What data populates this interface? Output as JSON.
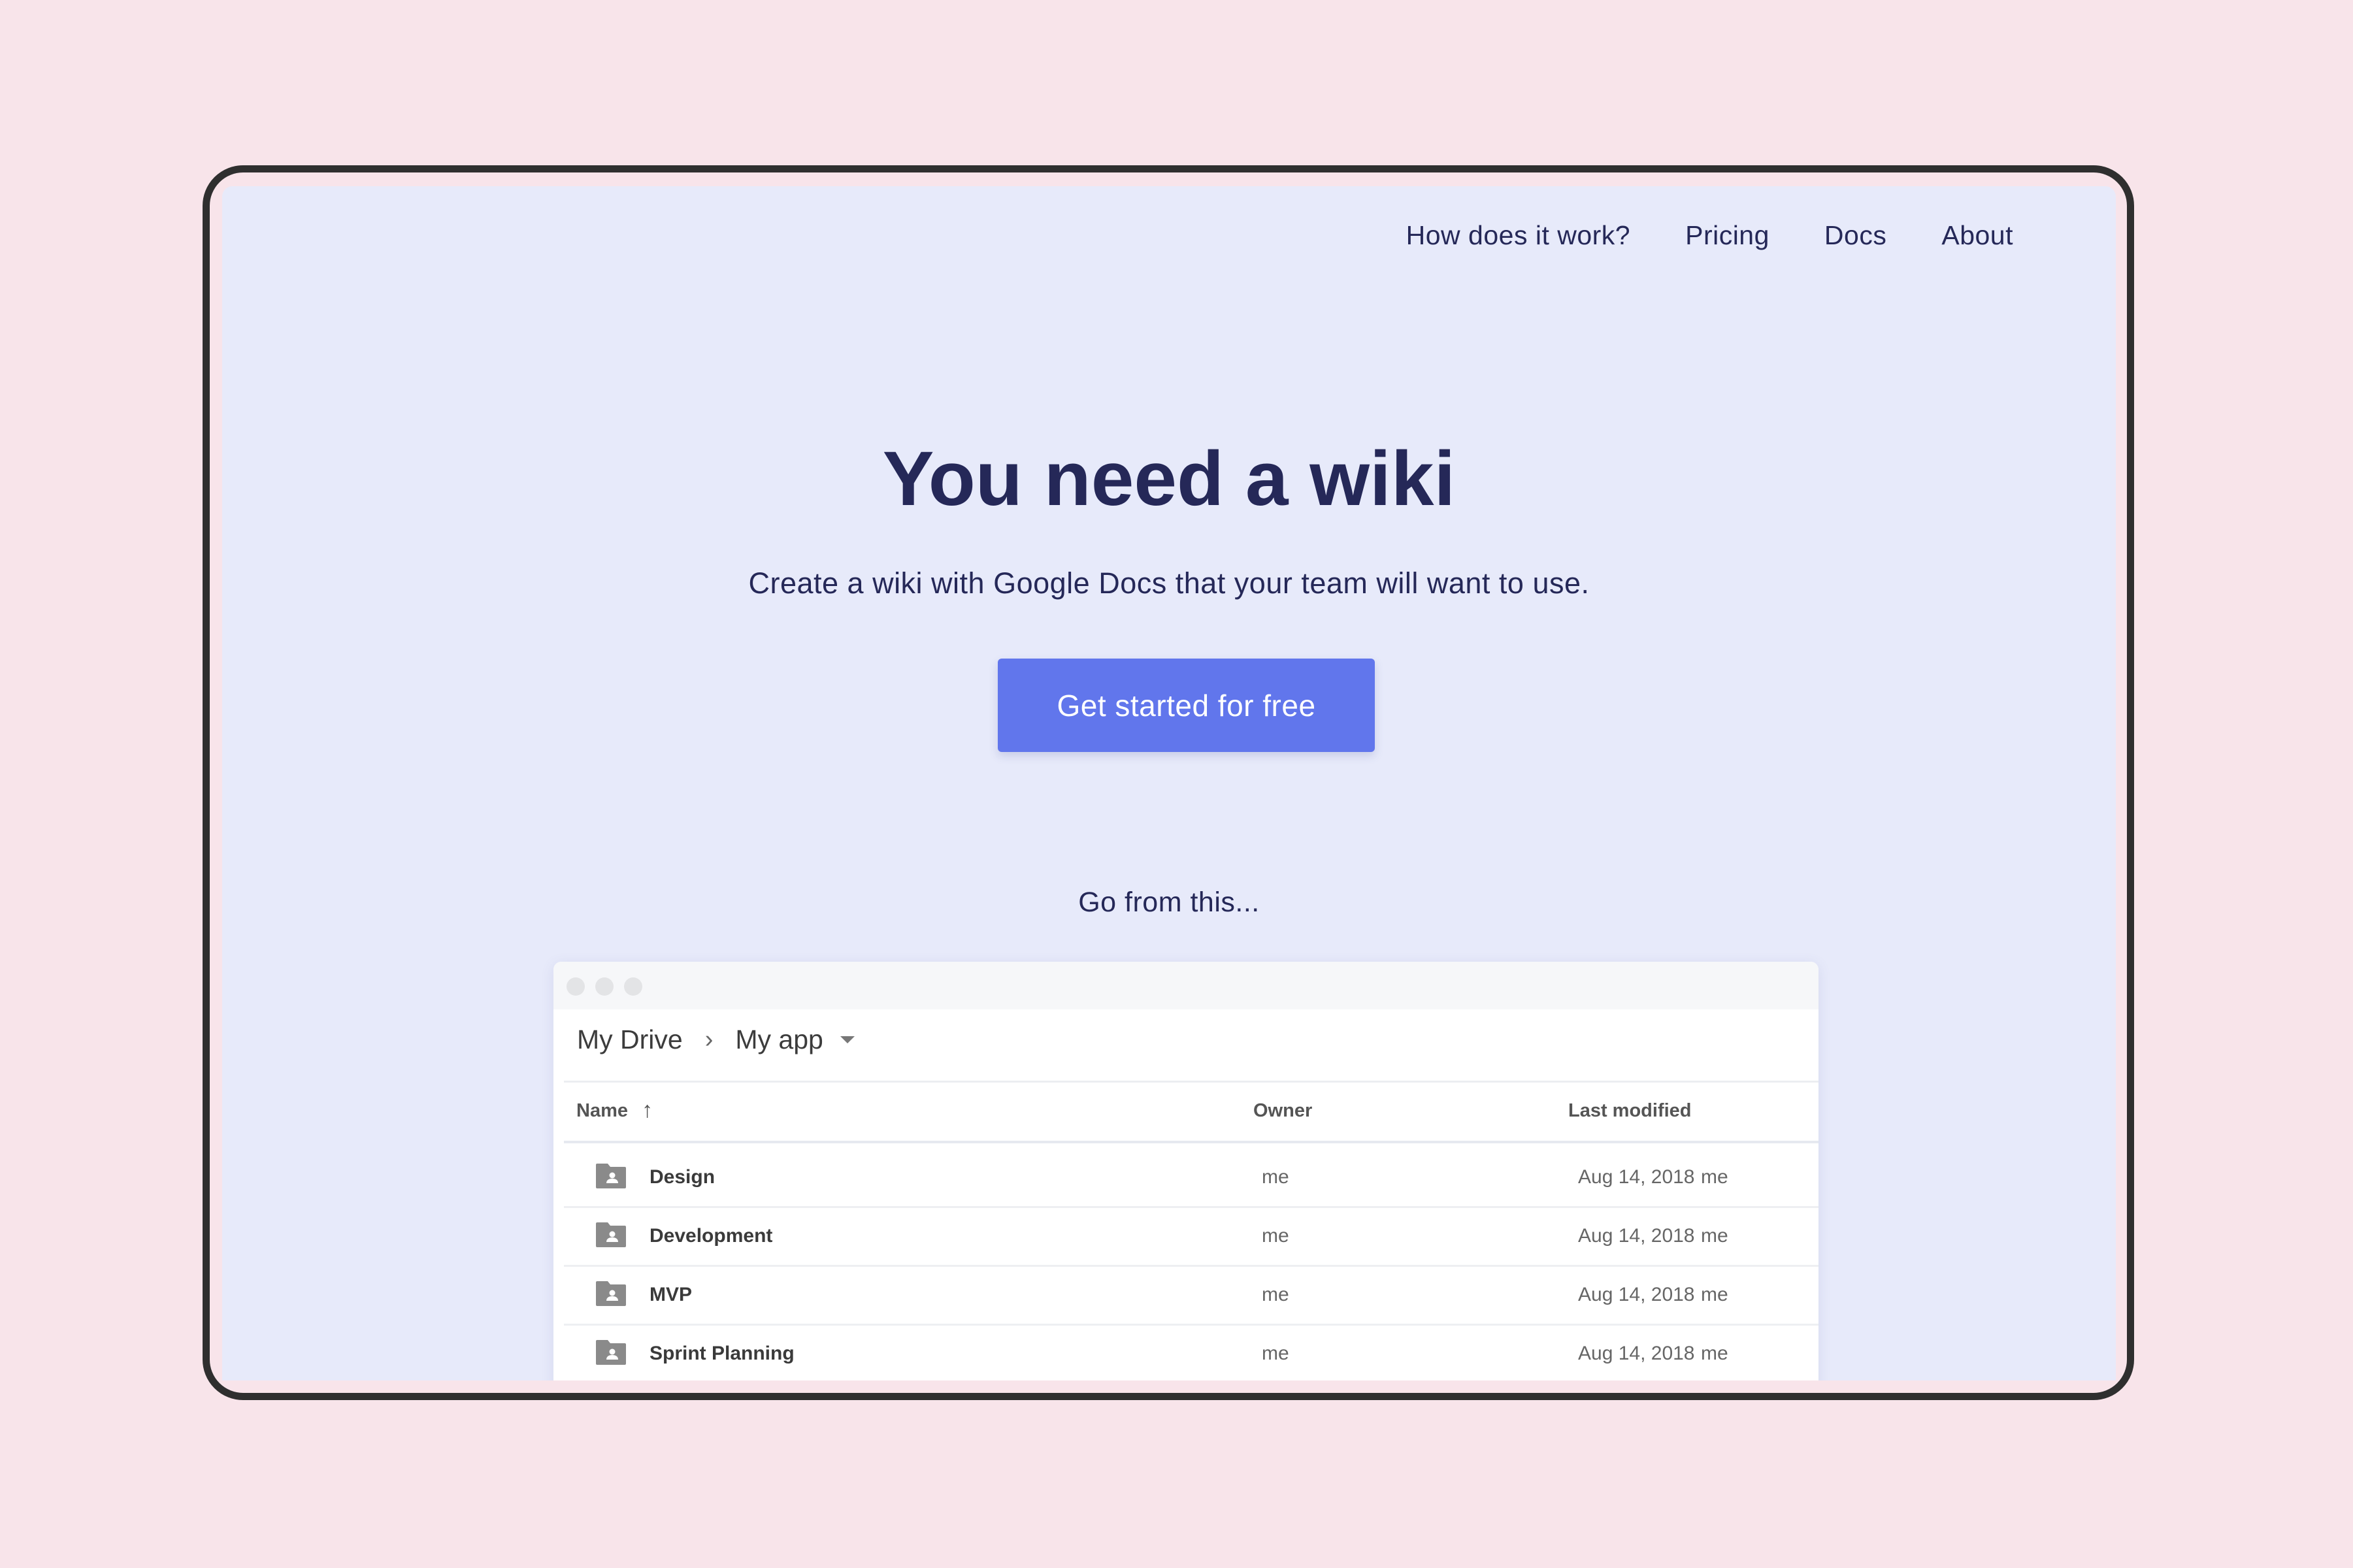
{
  "nav": {
    "items": [
      {
        "label": "How does it work?"
      },
      {
        "label": "Pricing"
      },
      {
        "label": "Docs"
      },
      {
        "label": "About"
      }
    ]
  },
  "hero": {
    "title": "You need a wiki",
    "subtitle": "Create a wiki with Google Docs that your team will want to use.",
    "cta_label": "Get started for free",
    "go_from": "Go from this..."
  },
  "colors": {
    "background": "#f8e4ea",
    "page": "#e7eafa",
    "text": "#252858",
    "accent": "#6176ec",
    "frame": "#2f2f2f"
  },
  "drive": {
    "breadcrumb": {
      "root": "My Drive",
      "current": "My app",
      "separator_icon": "chevron-right-icon",
      "dropdown_icon": "caret-down-icon"
    },
    "columns": {
      "name": "Name",
      "owner": "Owner",
      "modified": "Last modified",
      "sort_icon": "arrow-up-icon"
    },
    "rows": [
      {
        "name": "Design",
        "owner": "me",
        "modified": "Aug 14, 2018",
        "modified_by": "me",
        "icon": "shared-folder-icon"
      },
      {
        "name": "Development",
        "owner": "me",
        "modified": "Aug 14, 2018",
        "modified_by": "me",
        "icon": "shared-folder-icon"
      },
      {
        "name": "MVP",
        "owner": "me",
        "modified": "Aug 14, 2018",
        "modified_by": "me",
        "icon": "shared-folder-icon"
      },
      {
        "name": "Sprint Planning",
        "owner": "me",
        "modified": "Aug 14, 2018",
        "modified_by": "me",
        "icon": "shared-folder-icon"
      }
    ]
  }
}
